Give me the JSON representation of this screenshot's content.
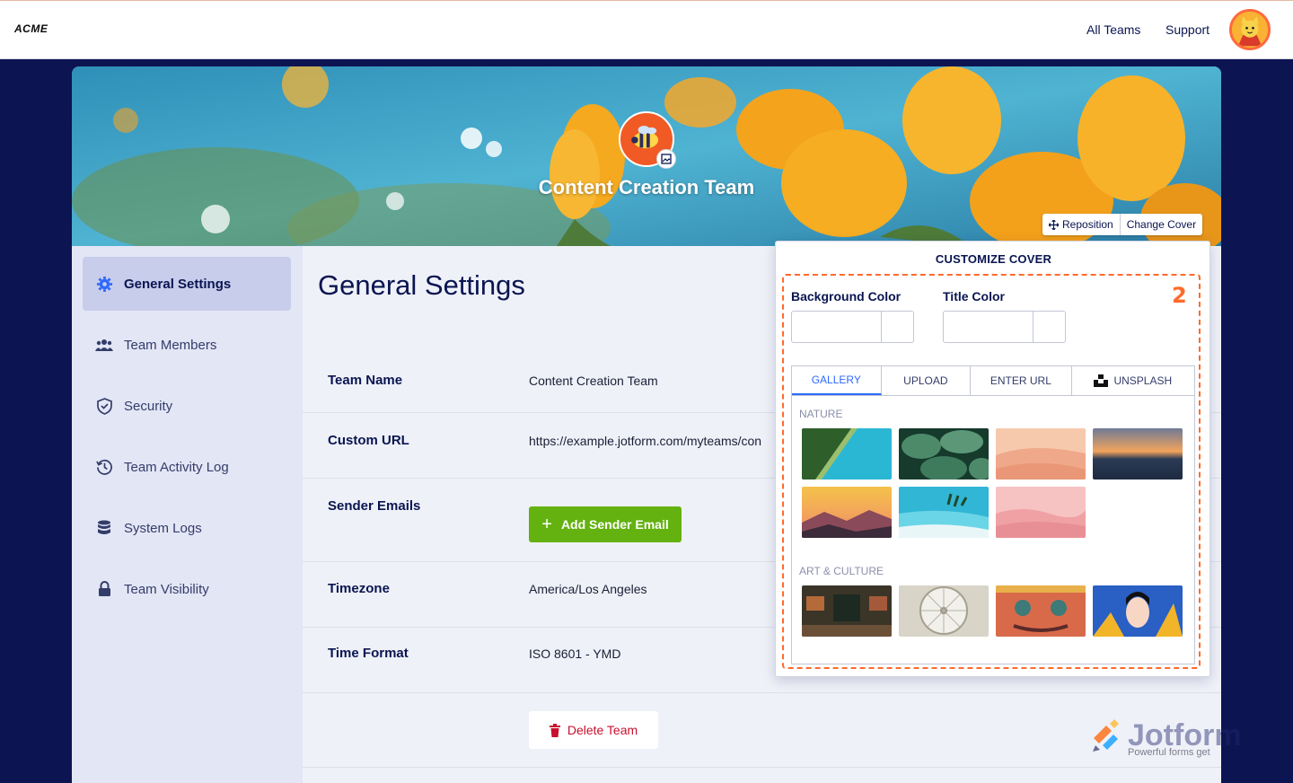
{
  "brand": {
    "logo": "ACME"
  },
  "nav": {
    "all_teams": "All Teams",
    "support": "Support"
  },
  "cover": {
    "team_name": "Content Creation Team",
    "reposition": "Reposition",
    "change_cover": "Change Cover"
  },
  "sidebar": {
    "items": [
      {
        "label": "General Settings",
        "icon": "gear-icon",
        "active": true
      },
      {
        "label": "Team Members",
        "icon": "users-icon"
      },
      {
        "label": "Security",
        "icon": "shield-icon"
      },
      {
        "label": "Team Activity Log",
        "icon": "history-icon"
      },
      {
        "label": "System Logs",
        "icon": "database-icon"
      },
      {
        "label": "Team Visibility",
        "icon": "lock-icon"
      }
    ]
  },
  "main": {
    "title": "General Settings",
    "rows": [
      {
        "label": "Team Name",
        "value": "Content Creation Team"
      },
      {
        "label": "Custom URL",
        "value": "https://example.jotform.com/myteams/con"
      },
      {
        "label": "Sender Emails",
        "button": "Add Sender Email"
      },
      {
        "label": "Timezone",
        "value": "America/Los Angeles"
      },
      {
        "label": "Time Format",
        "value": "ISO 8601 - YMD"
      }
    ],
    "delete_button": "Delete Team"
  },
  "panel": {
    "title": "CUSTOMIZE COVER",
    "step": "2",
    "background_color_label": "Background Color",
    "title_color_label": "Title Color",
    "tabs": [
      "GALLERY",
      "UPLOAD",
      "ENTER URL",
      "UNSPLASH"
    ],
    "active_tab": "GALLERY",
    "categories": [
      "NATURE",
      "ART & CULTURE"
    ]
  },
  "watermark": {
    "name": "Jotform",
    "tagline": "Powerful forms get"
  },
  "colors": {
    "navy": "#0a1551",
    "accent": "#ff6a2c",
    "green": "#64b210",
    "blue": "#2e69ff"
  }
}
